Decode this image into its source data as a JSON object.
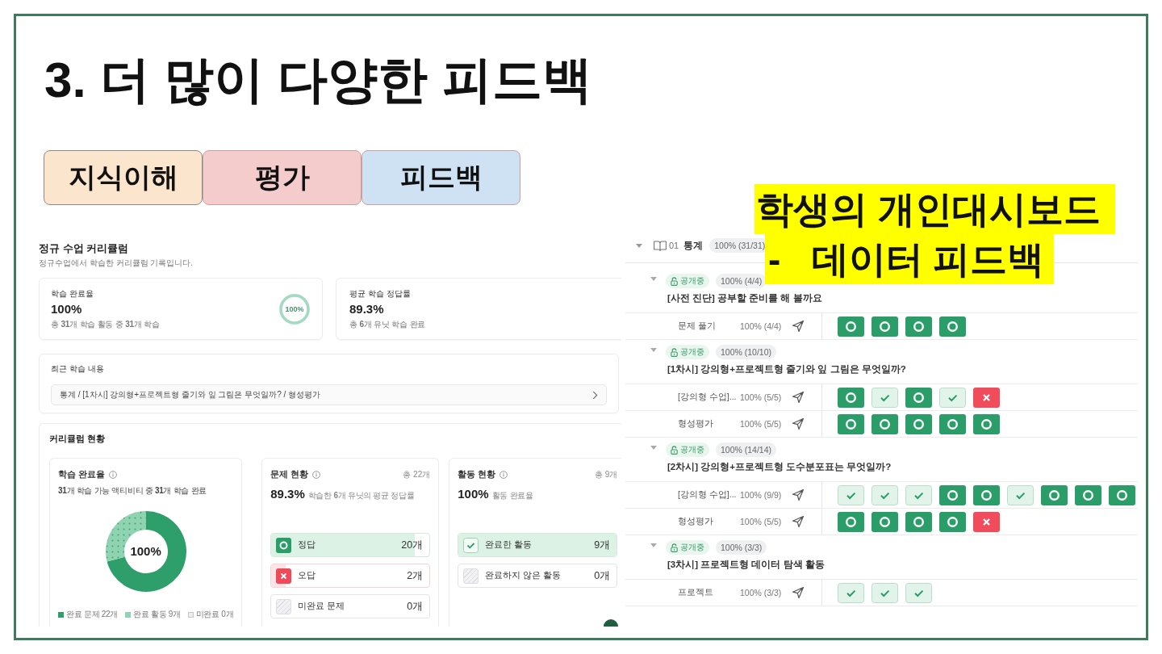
{
  "slide": {
    "title": "3. 더 많이 다양한 피드백",
    "categories": [
      {
        "label": "지식이해",
        "color": "#fce5cd"
      },
      {
        "label": "평가",
        "color": "#f4cccc"
      },
      {
        "label": "피드백",
        "color": "#cfe2f3"
      }
    ],
    "callout": {
      "lines": [
        "학생의 개인대시보드",
        "-   데이터 피드백"
      ]
    }
  },
  "curriculum": {
    "title": "정규 수업 커리큘럼",
    "subtitle": "정규수업에서 학습한 커리큘럼 기록입니다.",
    "summary_cards": [
      {
        "kind": "ring",
        "label": "학습 완료율",
        "value": "100%",
        "note": "총 **31**개 학습 활동 중 **31**개 학습",
        "ring_label": "100%",
        "level": 1
      },
      {
        "kind": "plain",
        "label": "평균 학습 정답률",
        "value": "89.3%",
        "note": "총 **6**개 유닛 학습 완료"
      }
    ],
    "recent": {
      "title": "최근 학습 내용",
      "path": "통계 / [1차시] 강의형+프로젝트형 줄기와 잎 그림은 무엇일까? / 형성평가"
    },
    "status": {
      "title": "커리큘럼 현황",
      "panels": [
        {
          "kind": "donut",
          "title": "학습 완료율",
          "note": "**31**개 학습 가능 액티비티 중 **31**개 학습 완료",
          "center_label": "100%",
          "chart_data": {
            "type": "donut",
            "categories": [
              "완료 문제 22개",
              "완료 활동 9개",
              "미완료 0개"
            ],
            "values": [
              22,
              9,
              0
            ]
          },
          "legend": [
            {
              "color": "#2e9e6a"
            },
            {
              "color": "#8fd3b0"
            },
            {
              "color": "#ececec"
            }
          ]
        },
        {
          "kind": "breakdown",
          "title": "문제 현황",
          "total": "총 22개",
          "value": "89.3%",
          "caption": "학습한 **6**개 유닛의 평균 정답률",
          "rows": [
            {
              "kind": "correct",
              "label": "정답",
              "count": "20개",
              "level": 0.909
            },
            {
              "kind": "wrong",
              "label": "오답",
              "count": "2개",
              "level": 0.091
            },
            {
              "kind": "incomplete",
              "label": "미완료 문제",
              "count": "0개",
              "level": 0
            }
          ]
        },
        {
          "kind": "breakdown",
          "title": "활동 현황",
          "total": "총 9개",
          "value": "100%",
          "caption": "활동 완료율",
          "rows": [
            {
              "kind": "done",
              "label": "완료한 활동",
              "count": "9개",
              "level": 1
            },
            {
              "kind": "incomplete",
              "label": "완료하지 않은 활동",
              "count": "0개",
              "level": 0
            }
          ]
        }
      ]
    }
  },
  "dashboard": {
    "unit": {
      "number": "01",
      "name": "통계",
      "progress": "100% (31/31)",
      "expanded": true
    },
    "lessons": [
      {
        "status": "공개중",
        "progress": "100% (4/4)",
        "title": "[사전 진단] 공부할 준비를 해 볼까요",
        "expanded": true,
        "activities": [
          {
            "name": "문제 풀기",
            "progress": "100% (4/4)",
            "results": [
              {
                "kind": "correct"
              },
              {
                "kind": "correct"
              },
              {
                "kind": "correct"
              },
              {
                "kind": "correct"
              }
            ]
          }
        ]
      },
      {
        "status": "공개중",
        "progress": "100% (10/10)",
        "title": "[1차시] 강의형+프로젝트형 줄기와 잎 그림은 무엇일까?",
        "expanded": true,
        "activities": [
          {
            "name": "[강의형 수업]...",
            "progress": "100% (5/5)",
            "results": [
              {
                "kind": "correct"
              },
              {
                "kind": "done"
              },
              {
                "kind": "correct"
              },
              {
                "kind": "done"
              },
              {
                "kind": "wrong"
              }
            ]
          },
          {
            "name": "형성평가",
            "progress": "100% (5/5)",
            "results": [
              {
                "kind": "correct"
              },
              {
                "kind": "correct"
              },
              {
                "kind": "correct"
              },
              {
                "kind": "correct"
              },
              {
                "kind": "correct"
              }
            ]
          }
        ]
      },
      {
        "status": "공개중",
        "progress": "100% (14/14)",
        "title": "[2차시] 강의형+프로젝트형 도수분포표는 무엇일까?",
        "expanded": true,
        "activities": [
          {
            "name": "[강의형 수업]...",
            "progress": "100% (9/9)",
            "results": [
              {
                "kind": "done"
              },
              {
                "kind": "done"
              },
              {
                "kind": "done"
              },
              {
                "kind": "correct"
              },
              {
                "kind": "correct"
              },
              {
                "kind": "done"
              },
              {
                "kind": "correct"
              },
              {
                "kind": "correct"
              },
              {
                "kind": "correct"
              }
            ]
          },
          {
            "name": "형성평가",
            "progress": "100% (5/5)",
            "results": [
              {
                "kind": "correct"
              },
              {
                "kind": "correct"
              },
              {
                "kind": "correct"
              },
              {
                "kind": "correct"
              },
              {
                "kind": "wrong"
              }
            ]
          }
        ]
      },
      {
        "status": "공개중",
        "progress": "100% (3/3)",
        "title": "[3차시] 프로젝트형 데이터 탐색 활동",
        "expanded": true,
        "activities": [
          {
            "name": "프로젝트",
            "progress": "100% (3/3)",
            "results": [
              {
                "kind": "done"
              },
              {
                "kind": "done"
              },
              {
                "kind": "done"
              }
            ]
          }
        ]
      }
    ]
  }
}
